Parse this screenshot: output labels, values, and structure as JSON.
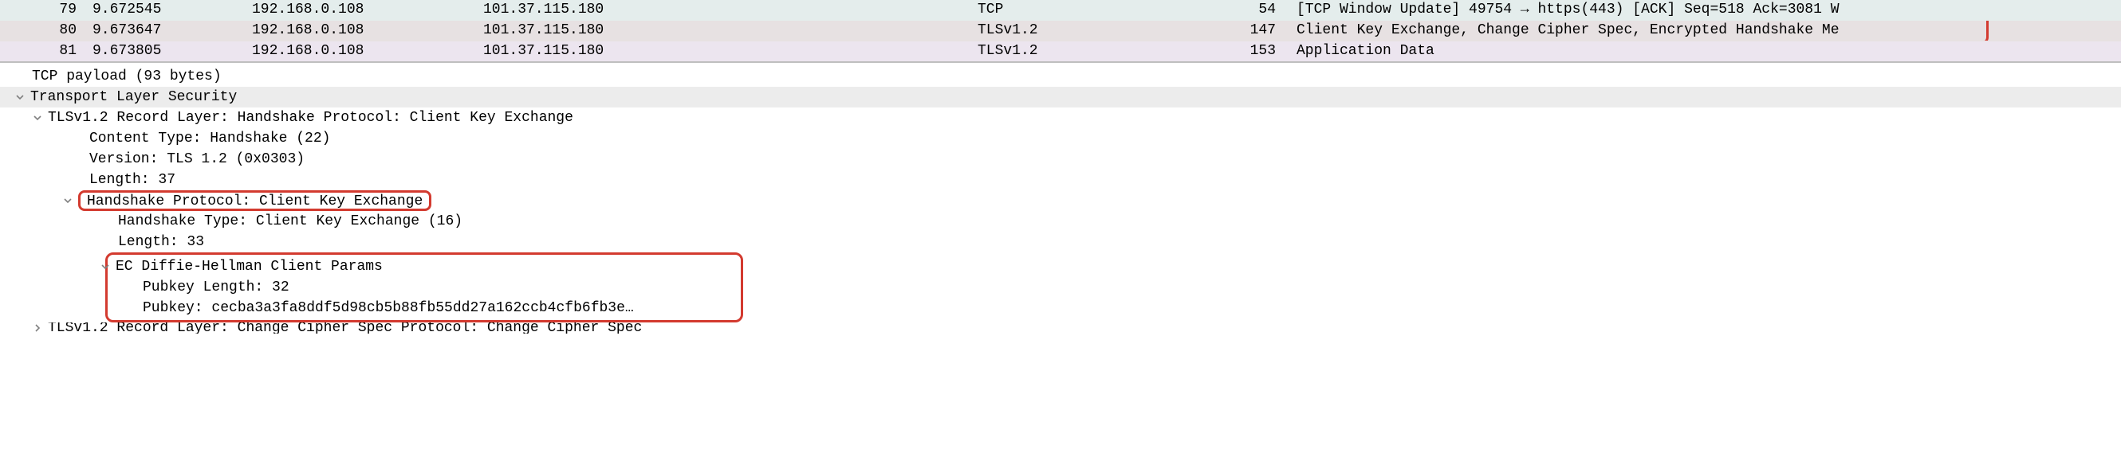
{
  "packets": [
    {
      "no": "79",
      "time": "9.672545",
      "src": "192.168.0.108",
      "dst": "101.37.115.180",
      "proto": "TCP",
      "len": "54",
      "info": "[TCP Window Update] 49754 → https(443) [ACK] Seq=518 Ack=3081 W"
    },
    {
      "no": "80",
      "time": "9.673647",
      "src": "192.168.0.108",
      "dst": "101.37.115.180",
      "proto": "TLSv1.2",
      "len": "147",
      "info": "Client Key Exchange, Change Cipher Spec, Encrypted Handshake Me"
    },
    {
      "no": "81",
      "time": "9.673805",
      "src": "192.168.0.108",
      "dst": "101.37.115.180",
      "proto": "TLSv1.2",
      "len": "153",
      "info": "Application Data"
    }
  ],
  "details": {
    "tcp_payload": "TCP payload (93 bytes)",
    "tls_root": "Transport Layer Security",
    "record_layer": "TLSv1.2 Record Layer: Handshake Protocol: Client Key Exchange",
    "content_type": "Content Type: Handshake (22)",
    "version": "Version: TLS 1.2 (0x0303)",
    "length1": "Length: 37",
    "handshake_proto": "Handshake Protocol: Client Key Exchange",
    "handshake_type": "Handshake Type: Client Key Exchange (16)",
    "length2": "Length: 33",
    "ecdh": "EC Diffie-Hellman Client Params",
    "pubkey_len": "Pubkey Length: 32",
    "pubkey": "Pubkey: cecba3a3fa8ddf5d98cb5b88fb55dd27a162ccb4cfb6fb3e…",
    "next_record": "TLSv1.2 Record Layer: Change Cipher Spec Protocol: Change Cipher Spec"
  }
}
